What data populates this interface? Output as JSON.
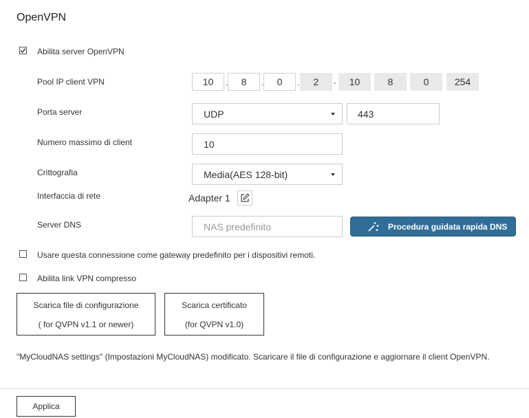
{
  "title": "OpenVPN",
  "enable_server": {
    "label": "Abilita server OpenVPN",
    "checked": true
  },
  "ip_pool": {
    "label": "Pool IP client VPN",
    "start": [
      "10",
      "8",
      "0",
      "2"
    ],
    "end": [
      "10",
      "8",
      "0",
      "254"
    ],
    "dash": "-",
    "dot": "."
  },
  "server_port": {
    "label": "Porta server",
    "protocol": "UDP",
    "port": "443"
  },
  "max_clients": {
    "label": "Numero massimo di client",
    "value": "10"
  },
  "encryption": {
    "label": "Crittografia",
    "value": "Media(AES 128-bit)"
  },
  "network_interface": {
    "label": "Interfaccia di rete",
    "value": "Adapter 1"
  },
  "dns": {
    "label": "Server DNS",
    "placeholder": "NAS predefinito",
    "wizard_label": "Procedura guidata rapida DNS"
  },
  "default_gateway": {
    "label": "Usare questa connessione come gateway predefinito per i dispositivi remoti.",
    "checked": false
  },
  "compressed_link": {
    "label": "Abilita link VPN compresso",
    "checked": false
  },
  "download_config": {
    "line1": "Scarica file di configurazione",
    "line2": "( for QVPN v1.1 or newer)"
  },
  "download_cert": {
    "line1": "Scarica certificato",
    "line2": "(for QVPN v1.0)"
  },
  "notice": "\"MyCloudNAS settings\" (Impostazioni MyCloudNAS) modificato. Scaricare il file di configurazione e aggiornare il client OpenVPN.",
  "apply_label": "Applica",
  "colors": {
    "accent": "#2e6e99",
    "disabled_field": "#e9e9e9"
  }
}
